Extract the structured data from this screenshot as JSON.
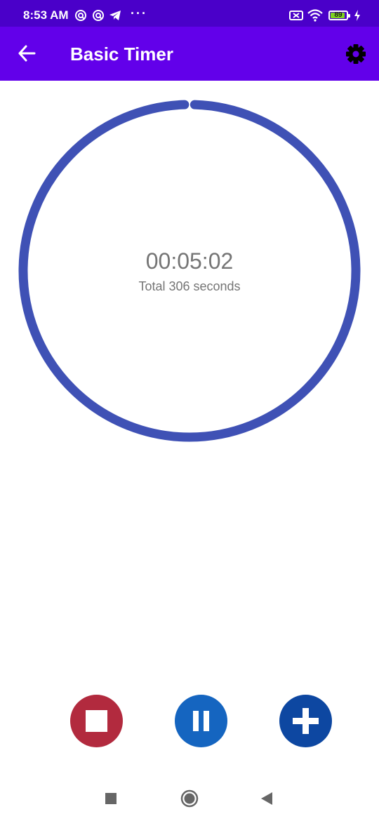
{
  "status_bar": {
    "time": "8:53 AM",
    "dots": "···",
    "battery_level": "89",
    "icons": [
      "notification-app-icon",
      "notification-app-icon",
      "telegram-icon",
      "battery-saver-icon",
      "wifi-icon",
      "battery-icon",
      "charging-icon"
    ]
  },
  "app_bar": {
    "title": "Basic Timer",
    "back_icon": "arrow-left-icon",
    "settings_icon": "gear-icon"
  },
  "timer": {
    "display": "00:05:02",
    "total_label": "Total 306 seconds",
    "ring_progress": 0.99
  },
  "controls": {
    "stop": {
      "icon": "stop-icon"
    },
    "pause": {
      "icon": "pause-icon"
    },
    "add": {
      "icon": "plus-icon"
    }
  },
  "nav_bar": {
    "recents_icon": "recents-square-icon",
    "home_icon": "home-circle-icon",
    "back_icon": "back-triangle-icon"
  },
  "colors": {
    "status_bar": "#4a00c9",
    "app_bar": "#6200ea",
    "ring": "#3f51b5",
    "stop": "#b22a3e",
    "pause": "#1565c0",
    "add": "#0d47a1",
    "timer_text": "#757575",
    "nav": "#666666"
  }
}
